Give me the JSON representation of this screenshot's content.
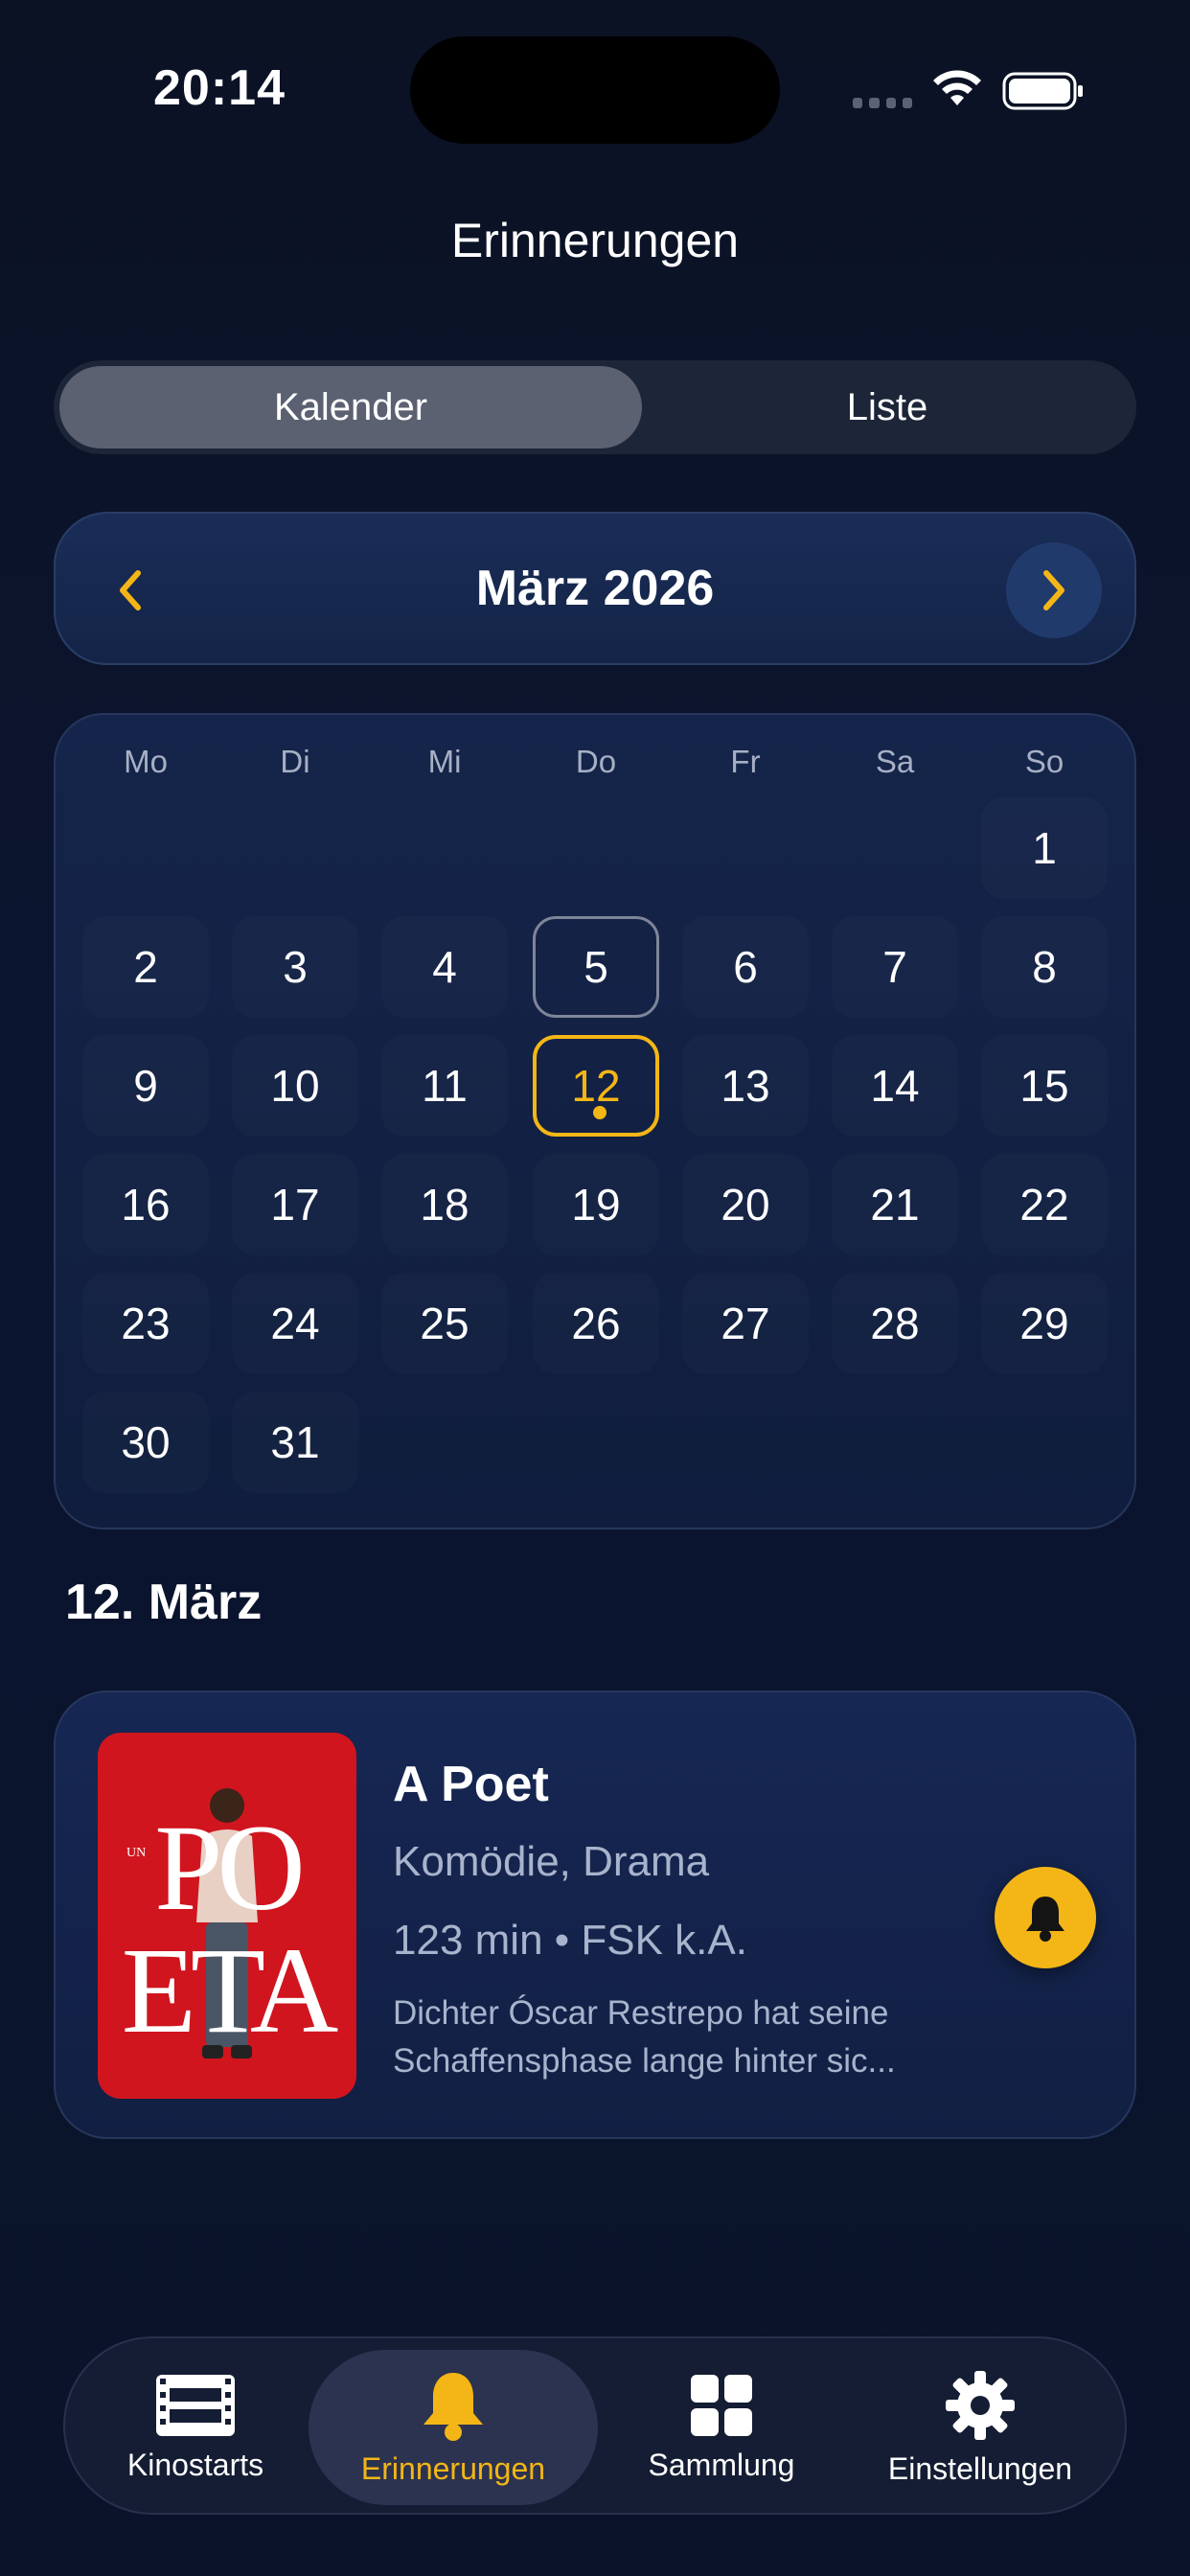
{
  "status_bar": {
    "time": "20:14"
  },
  "header": {
    "title": "Erinnerungen"
  },
  "view_switch": {
    "options": [
      {
        "label": "Kalender",
        "active": true
      },
      {
        "label": "Liste",
        "active": false
      }
    ]
  },
  "month_nav": {
    "title": "März 2026",
    "prev_icon": "chevron-left-icon",
    "next_icon": "chevron-right-icon"
  },
  "calendar": {
    "weekdays": [
      "Mo",
      "Di",
      "Mi",
      "Do",
      "Fr",
      "Sa",
      "So"
    ],
    "days": [
      "1",
      "2",
      "3",
      "4",
      "5",
      "6",
      "7",
      "8",
      "9",
      "10",
      "11",
      "12",
      "13",
      "14",
      "15",
      "16",
      "17",
      "18",
      "19",
      "20",
      "21",
      "22",
      "23",
      "24",
      "25",
      "26",
      "27",
      "28",
      "29",
      "30",
      "31"
    ],
    "today": "5",
    "selected": "12",
    "days_with_reminders": [
      "12"
    ]
  },
  "selected_day": {
    "title": "12. März"
  },
  "reminders": [
    {
      "poster_text_top": "PO",
      "poster_text_bottom": "ETA",
      "poster_text_small": "UN",
      "title": "A Poet",
      "genres": "Komödie, Drama",
      "meta": "123 min • FSK k.A.",
      "description": "Dichter Óscar Restrepo hat seine Schaffensphase lange hinter sic..."
    }
  ],
  "tabbar": {
    "items": [
      {
        "label": "Kinostarts",
        "icon": "film-icon",
        "active": false
      },
      {
        "label": "Erinnerungen",
        "icon": "bell-icon",
        "active": true
      },
      {
        "label": "Sammlung",
        "icon": "grid-icon",
        "active": false
      },
      {
        "label": "Einstellungen",
        "icon": "gear-icon",
        "active": false
      }
    ]
  },
  "colors": {
    "accent": "#f4b616",
    "background": "#0b1224",
    "card": "#15244a",
    "secondary_text": "#a8b3cc"
  }
}
